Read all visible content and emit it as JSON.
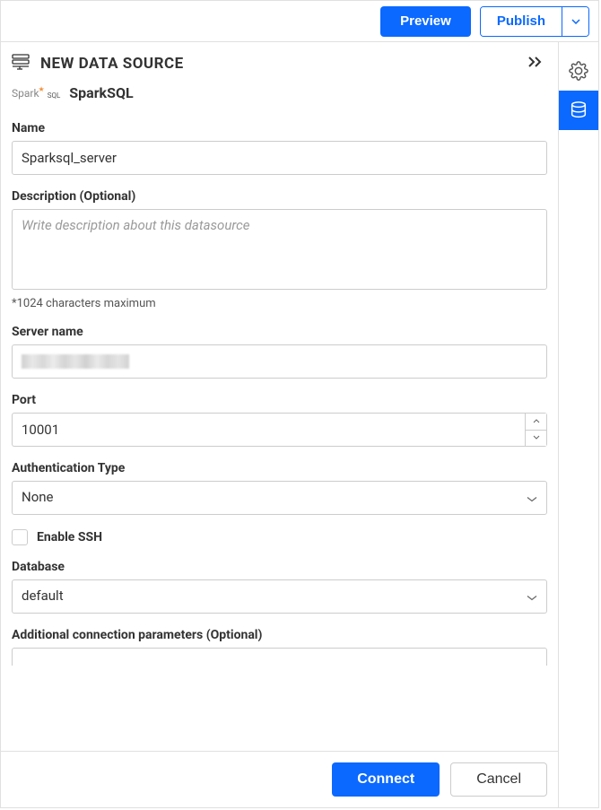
{
  "top": {
    "preview_label": "Preview",
    "publish_label": "Publish"
  },
  "panel": {
    "title": "NEW DATA SOURCE",
    "db_type": "SparkSQL"
  },
  "form": {
    "name_label": "Name",
    "name_value": "Sparksql_server",
    "description_label": "Description (Optional)",
    "description_placeholder": "Write description about this datasource",
    "description_helper": "*1024 characters maximum",
    "server_label": "Server name",
    "server_value": "",
    "port_label": "Port",
    "port_value": "10001",
    "auth_label": "Authentication Type",
    "auth_value": "None",
    "ssh_label": "Enable SSH",
    "ssh_checked": false,
    "database_label": "Database",
    "database_value": "default",
    "additional_label": "Additional connection parameters (Optional)"
  },
  "footer": {
    "connect_label": "Connect",
    "cancel_label": "Cancel"
  }
}
